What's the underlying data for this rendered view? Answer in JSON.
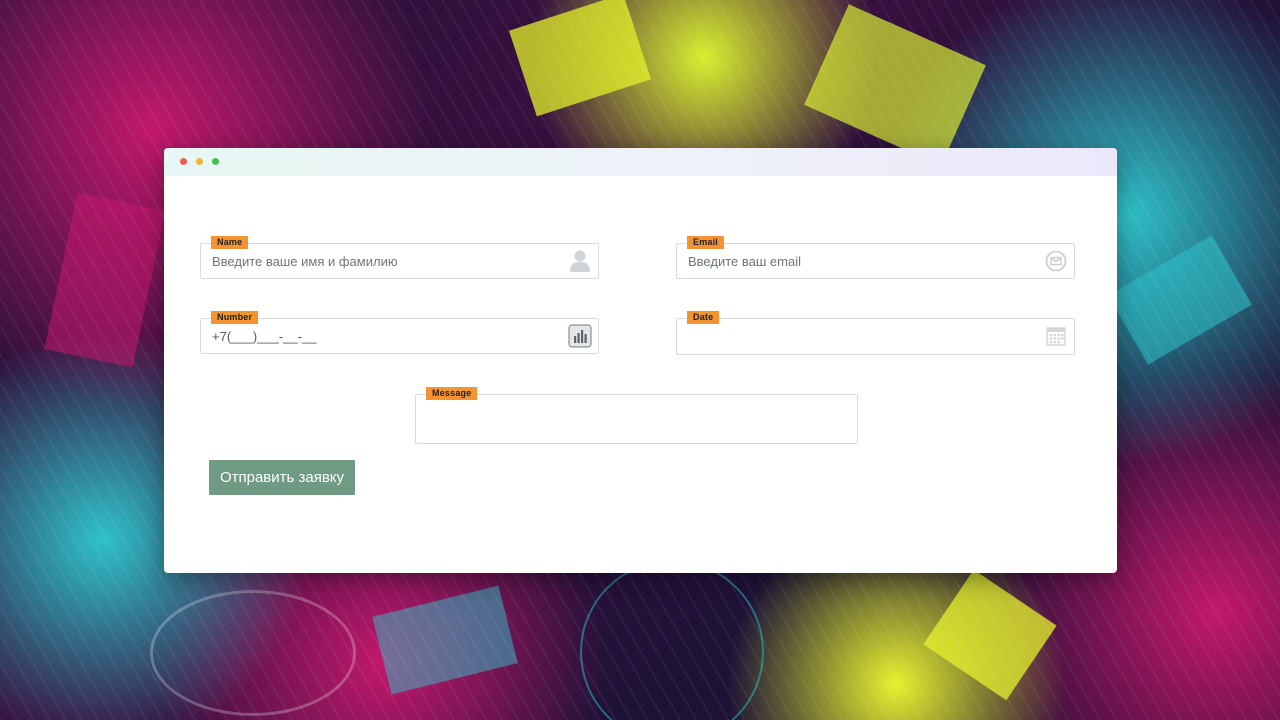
{
  "form": {
    "name": {
      "label": "Name",
      "placeholder": "Введите ваше имя и фамилию",
      "icon": "user-icon"
    },
    "email": {
      "label": "Email",
      "placeholder": "Введите ваш email",
      "icon": "envelope-icon"
    },
    "number": {
      "label": "Number",
      "value": "+7(___)___-__-__",
      "icon": "bar-chart-icon"
    },
    "date": {
      "label": "Date",
      "value": "",
      "icon": "calendar-icon"
    },
    "message": {
      "label": "Message",
      "value": ""
    },
    "submit_label": "Отправить заявку"
  },
  "colors": {
    "tag": "#f59333",
    "button": "#6f9a84",
    "window_dot_red": "#ee5b57",
    "window_dot_yellow": "#f2b33c",
    "window_dot_green": "#45c24b"
  }
}
